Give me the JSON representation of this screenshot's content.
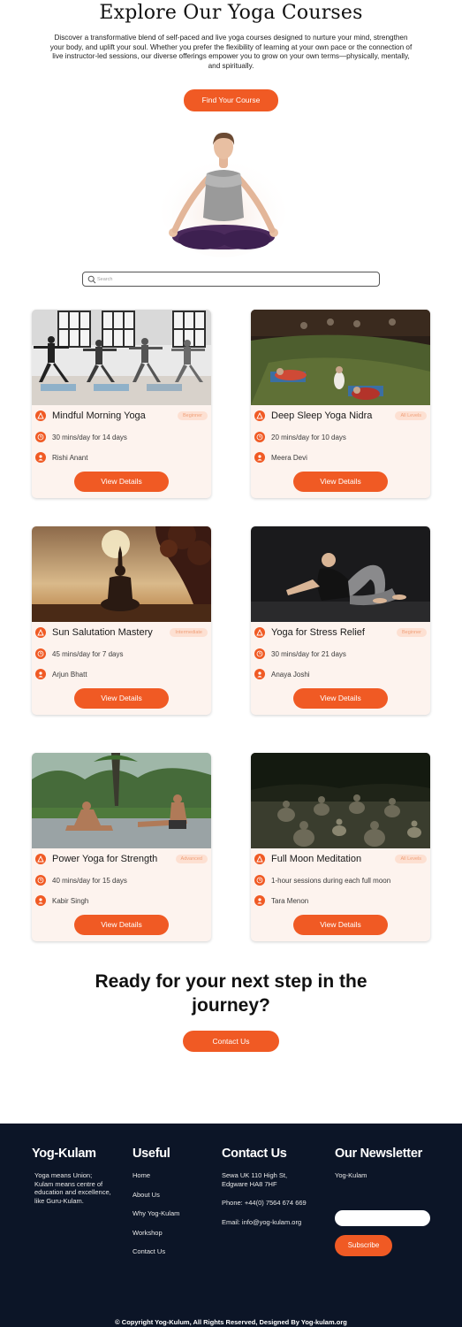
{
  "hero": {
    "title": "Explore Our Yoga Courses",
    "description": "Discover a transformative blend of self-paced and live yoga courses designed to nurture your mind, strengthen your body, and uplift your soul. Whether you prefer the flexibility of learning at your own pace or the connection of live instructor-led sessions, our diverse offerings empower you to grow on your own terms—physically, mentally, and spiritually.",
    "cta_label": "Find Your Course"
  },
  "search": {
    "placeholder": "Search"
  },
  "colors": {
    "accent": "#f05a24",
    "card_bg": "#fdf3ee",
    "badge_bg": "#fde0d2",
    "footer_bg": "#0c1527"
  },
  "courses": [
    {
      "title": "Mindful Morning Yoga",
      "level": "Beginner",
      "schedule": "30 mins/day for 14 days",
      "instructor": "Rishi Anant",
      "button": "View Details"
    },
    {
      "title": "Deep Sleep Yoga Nidra",
      "level": "All Levels",
      "schedule": "20 mins/day for 10 days",
      "instructor": "Meera Devi",
      "button": "View Details"
    },
    {
      "title": "Sun Salutation Mastery",
      "level": "Intermediate",
      "schedule": "45 mins/day for 7 days",
      "instructor": "Arjun Bhatt",
      "button": "View Details"
    },
    {
      "title": "Yoga for Stress Relief",
      "level": "Beginner",
      "schedule": "30 mins/day for 21 days",
      "instructor": "Anaya Joshi",
      "button": "View Details"
    },
    {
      "title": "Power Yoga for Strength",
      "level": "Advanced",
      "schedule": "40 mins/day for 15 days",
      "instructor": "Kabir Singh",
      "button": "View Details"
    },
    {
      "title": "Full Moon Meditation",
      "level": "All Levels",
      "schedule": "1-hour sessions during each full moon",
      "instructor": "Tara Menon",
      "button": "View Details"
    }
  ],
  "cta_section": {
    "heading_line1": "Ready for your next step in the",
    "heading_line2": "journey?",
    "button": "Contact Us"
  },
  "footer": {
    "brand": {
      "title": "Yog-Kulam",
      "text": "Yoga means Union; Kulam means centre of education and excellence, like Guru-Kulam."
    },
    "useful": {
      "title": "Useful",
      "links": [
        "Home",
        "About Us",
        "Why Yog-Kulam",
        "Workshop",
        "Contact Us"
      ]
    },
    "contact": {
      "title": "Contact Us",
      "address": "Sewa UK 110 High St, Edgware HA8 7HF",
      "phone": "Phone: +44(0) 7564 674 669",
      "email": "Email: info@yog-kulam.org"
    },
    "newsletter": {
      "title": "Our Newsletter",
      "label": "Yog-Kulam",
      "button": "Subscribe"
    },
    "copyright": "© Copyright Yog-Kulum, All Rights Reserved,  Designed By Yog-kulam.org"
  }
}
